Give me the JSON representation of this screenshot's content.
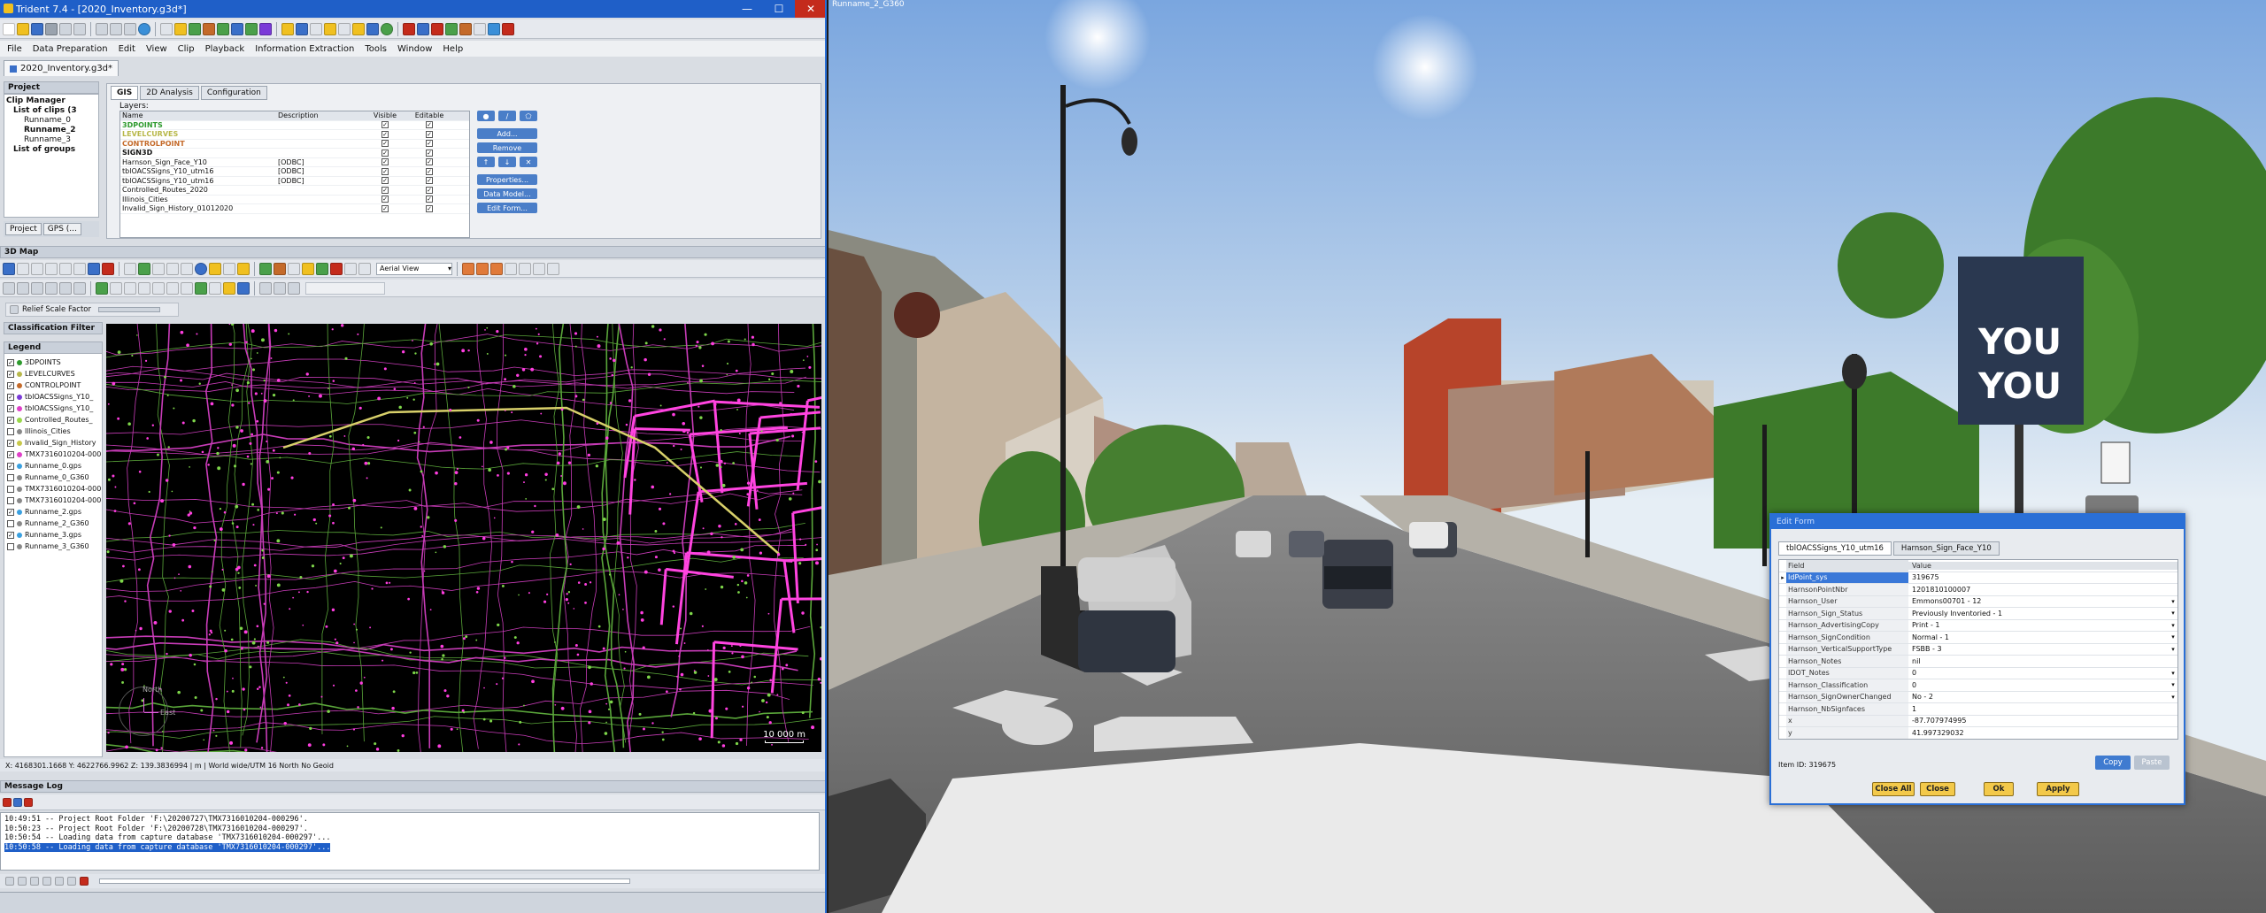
{
  "window": {
    "title": "Trident 7.4 - [2020_Inventory.g3d*]",
    "min": "—",
    "max": "☐",
    "close": "✕"
  },
  "menu": [
    "File",
    "Data Preparation",
    "Edit",
    "View",
    "Clip",
    "Playback",
    "Information Extraction",
    "Tools",
    "Window",
    "Help"
  ],
  "doc_tab": "2020_Inventory.g3d*",
  "project": {
    "title": "Project",
    "tree": [
      "Clip Manager",
      "List of clips (3",
      "Runname_0",
      "Runname_2",
      "Runname_3",
      "List of groups"
    ],
    "tabs": [
      "Project",
      "GPS (..."
    ]
  },
  "gis": {
    "tabs": [
      "GIS",
      "2D Analysis",
      "Configuration"
    ],
    "layers_label": "Layers:",
    "columns": [
      "Name",
      "Description",
      "Visible",
      "Editable"
    ],
    "layers": [
      {
        "name": "3DPOINTS",
        "desc": "",
        "color": "#2e9a2e"
      },
      {
        "name": "LEVELCURVES",
        "desc": "",
        "color": "#b8b84a"
      },
      {
        "name": "CONTROLPOINT",
        "desc": "",
        "color": "#c46a2a"
      },
      {
        "name": "SIGN3D",
        "desc": "",
        "color": "#111111"
      },
      {
        "name": "Harnson_Sign_Face_Y10",
        "desc": "[ODBC]",
        "color": "#111111"
      },
      {
        "name": "tblOACSSigns_Y10_utm16",
        "desc": "[ODBC]",
        "color": "#111111"
      },
      {
        "name": "tblOACSSigns_Y10_utm16",
        "desc": "[ODBC]",
        "color": "#111111"
      },
      {
        "name": "Controlled_Routes_2020",
        "desc": "",
        "color": "#111111"
      },
      {
        "name": "Illinois_Cities",
        "desc": "",
        "color": "#111111"
      },
      {
        "name": "Invalid_Sign_History_01012020",
        "desc": "",
        "color": "#111111"
      }
    ],
    "buttons": [
      "Add...",
      "Remove",
      "Properties...",
      "Data Model...",
      "Edit Form..."
    ]
  },
  "map3d": {
    "title": "3D Map",
    "view_select": "Aerial View",
    "relief": "Relief Scale Factor",
    "north": "North",
    "east": "East",
    "scale": "10 000 m",
    "status": "X: 4168301.1668  Y: 4622766.9962  Z: 139.3836994 | m | World wide/UTM 16 North No Geoid"
  },
  "classification_filter": "Classification Filter",
  "legend": {
    "title": "Legend",
    "items": [
      {
        "label": "3DPOINTS",
        "checked": true,
        "color": "#2e9a2e"
      },
      {
        "label": "LEVELCURVES",
        "checked": true,
        "color": "#b8b84a"
      },
      {
        "label": "CONTROLPOINT",
        "checked": true,
        "color": "#c46a2a"
      },
      {
        "label": "tblOACSSigns_Y10_",
        "checked": true,
        "color": "#7a3ad8"
      },
      {
        "label": "tblOACSSigns_Y10_",
        "checked": true,
        "color": "#e040c8"
      },
      {
        "label": "Controlled_Routes_",
        "checked": true,
        "color": "#9ad84a"
      },
      {
        "label": "Illinois_Cities",
        "checked": false,
        "color": "#888888"
      },
      {
        "label": "Invalid_Sign_History",
        "checked": true,
        "color": "#c8c84a"
      },
      {
        "label": "TMX7316010204-000",
        "checked": true,
        "color": "#e040c8"
      },
      {
        "label": "Runname_0.gps",
        "checked": true,
        "color": "#3aa0e0"
      },
      {
        "label": "Runname_0_G360",
        "checked": false,
        "color": "#888888"
      },
      {
        "label": "TMX7316010204-000",
        "checked": false,
        "color": "#888888"
      },
      {
        "label": "TMX7316010204-000",
        "checked": false,
        "color": "#888888"
      },
      {
        "label": "Runname_2.gps",
        "checked": true,
        "color": "#3aa0e0"
      },
      {
        "label": "Runname_2_G360",
        "checked": false,
        "color": "#888888"
      },
      {
        "label": "Runname_3.gps",
        "checked": true,
        "color": "#3aa0e0"
      },
      {
        "label": "Runname_3_G360",
        "checked": false,
        "color": "#888888"
      }
    ]
  },
  "message_log": {
    "title": "Message Log",
    "lines": [
      "10:49:51 -- Project Root Folder 'F:\\20200727\\TMX7316010204-000296'.",
      "10:50:23 -- Project Root Folder 'F:\\20200728\\TMX7316010204-000297'.",
      "10:50:54 -- Loading data from capture database 'TMX7316010204-000297'...",
      "10:50:58 -- Loading data from capture database 'TMX7316010204-000297'..."
    ]
  },
  "video": {
    "title": "Runname_2_G360"
  },
  "edit_form": {
    "title": "Edit Form",
    "tabs": [
      "tblOACSSigns_Y10_utm16",
      "Harnson_Sign_Face_Y10"
    ],
    "header": {
      "field": "Field",
      "value": "Value"
    },
    "rows": [
      {
        "field": "IdPoint_sys",
        "value": "319675",
        "dd": false
      },
      {
        "field": "HarnsonPointNbr",
        "value": "1201810100007",
        "dd": false
      },
      {
        "field": "Harnson_User",
        "value": "Emmons00701 - 12",
        "dd": true
      },
      {
        "field": "Harnson_Sign_Status",
        "value": "Previously Inventoried - 1",
        "dd": true
      },
      {
        "field": "Harnson_AdvertisingCopy",
        "value": "Print - 1",
        "dd": true
      },
      {
        "field": "Harnson_SignCondition",
        "value": "Normal - 1",
        "dd": true
      },
      {
        "field": "Harnson_VerticalSupportType",
        "value": "FSBB - 3",
        "dd": true
      },
      {
        "field": "Harnson_Notes",
        "value": "nil",
        "dd": false
      },
      {
        "field": "IDOT_Notes",
        "value": "0",
        "dd": true
      },
      {
        "field": "Harnson_Classification",
        "value": "0",
        "dd": true
      },
      {
        "field": "Harnson_SignOwnerChanged",
        "value": "No - 2",
        "dd": true
      },
      {
        "field": "Harnson_NbSignfaces",
        "value": "1",
        "dd": false
      },
      {
        "field": "x",
        "value": "-87.707974995",
        "dd": false
      },
      {
        "field": "y",
        "value": "41.997329032",
        "dd": false
      }
    ],
    "item_id": "Item ID: 319675",
    "buttons": {
      "copy": "Copy",
      "paste": "Paste",
      "close_all": "Close All",
      "close": "Close",
      "ok": "Ok",
      "apply": "Apply"
    }
  }
}
